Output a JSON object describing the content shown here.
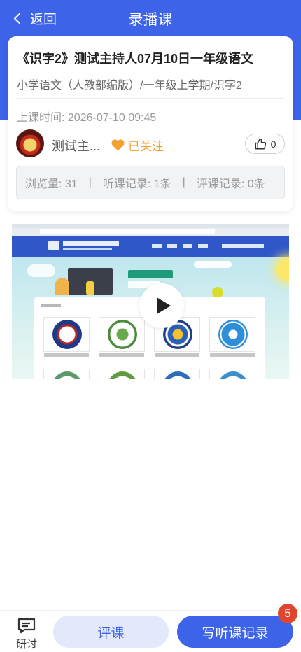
{
  "header": {
    "back_label": "返回",
    "title": "录播课"
  },
  "course": {
    "title": "《识字2》测试主持人07月10日一年级语文",
    "subtitle": "小学语文（人教部编版）/一年级上学期/识字2",
    "time_label": "上课时间:",
    "time_value": "2026-07-10 09:45",
    "host_name": "测试主...",
    "follow_label": "已关注",
    "like_count": "0",
    "colors": {
      "accent": "#3d63e8",
      "follow": "#f2a12d"
    }
  },
  "stats": {
    "views": "浏览量: 31",
    "listen_records": "听课记录: 1条",
    "review_records": "评课记录: 0条"
  },
  "video": {
    "play_icon": "play-icon"
  },
  "bottom": {
    "discuss_label": "研讨",
    "review_label": "评课",
    "write_label": "写听课记录",
    "badge_count": "5",
    "badge_color": "#e0452d"
  }
}
